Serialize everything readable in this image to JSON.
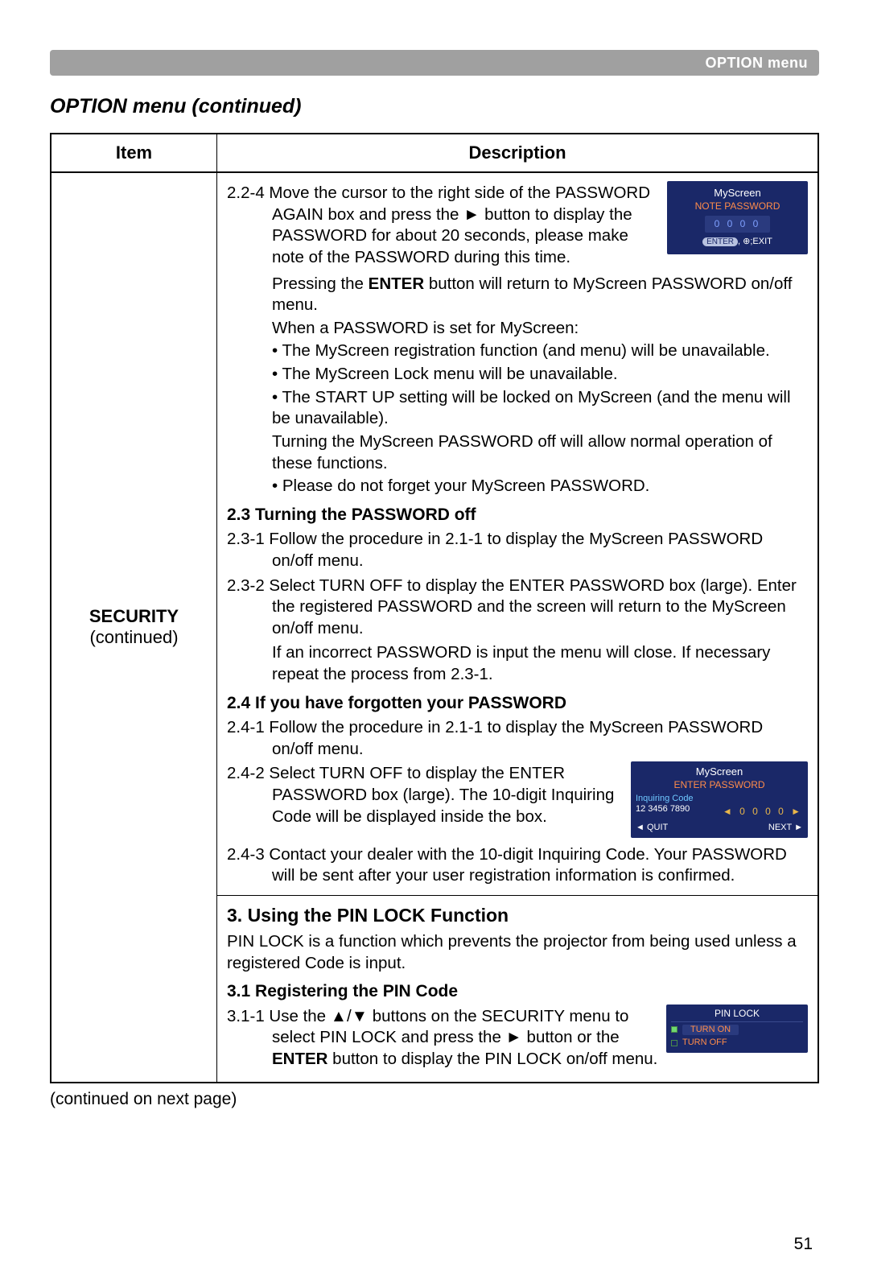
{
  "header": {
    "breadcrumb": "OPTION menu"
  },
  "section_title": "OPTION menu (continued)",
  "table": {
    "headers": {
      "item": "Item",
      "description": "Description"
    },
    "item_cell": {
      "line1": "SECURITY",
      "line2": "(continued)"
    }
  },
  "desc": {
    "p224_a": "2.2-4 Move the cursor to the right side of the PASSWORD AGAIN box and press the ► button to display the PASSWORD for about 20 seconds, please make note of the PASSWORD during this time.",
    "p224_b": "Pressing the ENTER button will return to MyScreen PASSWORD on/off menu.",
    "p224_c": "When a PASSWORD is set for MyScreen:",
    "bullet1": "• The MyScreen registration function (and menu) will be unavailable.",
    "bullet2": "• The MyScreen Lock menu will be unavailable.",
    "bullet3": "• The START UP setting will be locked on MyScreen (and the menu will be unavailable).",
    "p224_d": "Turning the MyScreen PASSWORD off will allow normal operation of these functions.",
    "bullet4": "• Please do not forget your MyScreen PASSWORD.",
    "h23": "2.3 Turning the PASSWORD off",
    "p231": "2.3-1 Follow the procedure in 2.1-1 to display the MyScreen PASSWORD on/off menu.",
    "p232": "2.3-2 Select TURN OFF to display the ENTER PASSWORD box (large). Enter the registered PASSWORD and the screen will return to the MyScreen on/off menu.",
    "p232b": "If an incorrect PASSWORD is input the menu will close. If necessary repeat the process from 2.3-1.",
    "h24": "2.4 If you have forgotten your PASSWORD",
    "p241": "2.4-1 Follow the procedure in 2.1-1 to display the MyScreen PASSWORD on/off menu.",
    "p242": "2.4-2 Select TURN OFF to display the ENTER PASSWORD box (large). The 10-digit Inquiring Code will be displayed inside the box.",
    "p243": "2.4-3 Contact your dealer with the 10-digit Inquiring Code. Your PASSWORD will be sent after your user registration information is confirmed.",
    "h3": "3. Using the PIN LOCK Function",
    "p3a": "PIN LOCK is a function which prevents the projector from being used unless a registered Code is input.",
    "h31": "3.1 Registering the PIN Code",
    "p311": "3.1-1 Use the ▲/▼ buttons on the SECURITY menu to select PIN LOCK and press the ► button or the ENTER button to display the PIN LOCK on/off menu."
  },
  "panel_note": {
    "title": "MyScreen",
    "subtitle": "NOTE PASSWORD",
    "digits": "0 0 0 0",
    "hint_enter": "ENTER",
    "hint_exit": ";EXIT",
    "hint_sep": ", ⊕"
  },
  "panel_enter": {
    "title": "MyScreen",
    "subtitle": "ENTER PASSWORD",
    "inq_label": "Inquiring Code",
    "inq_code": "12 3456 7890",
    "digits": "◄ 0 0 0 0 ►",
    "quit": "◄ QUIT",
    "next": "NEXT ►"
  },
  "panel_pin": {
    "title": "PIN LOCK",
    "on": "TURN ON",
    "off": "TURN OFF"
  },
  "cont_note": "(continued on next page)",
  "page": "51"
}
